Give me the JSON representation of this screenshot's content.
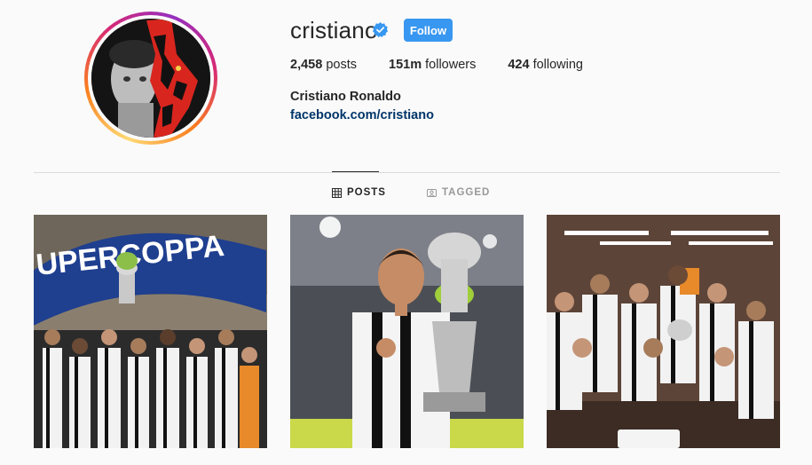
{
  "profile": {
    "username": "cristiano",
    "follow_label": "Follow",
    "full_name": "Cristiano Ronaldo",
    "website": "facebook.com/cristiano",
    "stats": {
      "posts_count": "2,458",
      "posts_label": "posts",
      "followers_count": "151m",
      "followers_label": "followers",
      "following_count": "424",
      "following_label": "following"
    }
  },
  "tabs": {
    "posts_label": "POSTS",
    "tagged_label": "TAGGED",
    "active": "posts"
  },
  "posts": {
    "post1_banner_text": "UPERCOPPA"
  },
  "colors": {
    "follow_button": "#3897f0",
    "link": "#003569",
    "verified_badge": "#3897f0",
    "divider": "#dbdbdb"
  },
  "icons": {
    "verified": "verified-badge-icon",
    "posts_tab": "grid-icon",
    "tagged_tab": "tagged-icon"
  }
}
